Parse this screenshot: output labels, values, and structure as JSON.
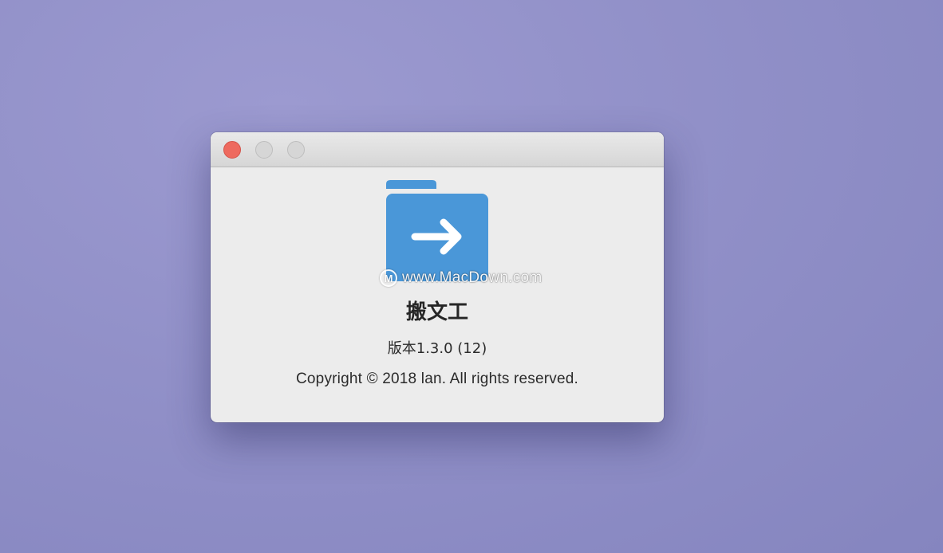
{
  "about_window": {
    "app_name": "搬文工",
    "version_text": "版本1.3.0 (12)",
    "copyright_text": "Copyright © 2018 lan. All rights reserved.",
    "app_icon": "folder-arrow-right-icon",
    "app_icon_color": "#4a97d8"
  },
  "titlebar": {
    "buttons": [
      {
        "name": "close",
        "color": "#ee6a5f"
      },
      {
        "name": "minimize",
        "color": "#d6d6d6"
      },
      {
        "name": "zoom",
        "color": "#d6d6d6"
      }
    ]
  },
  "watermark": {
    "logo_letter": "M",
    "text": "www.MacDown.com"
  }
}
